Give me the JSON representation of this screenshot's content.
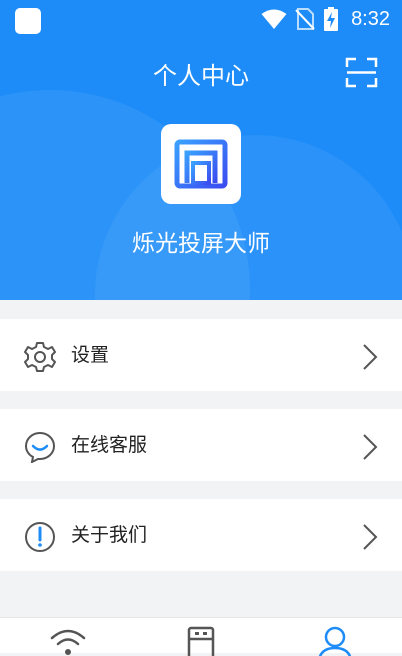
{
  "colors": {
    "brand": "#1d8cf8",
    "background": "#f2f3f5",
    "card": "#ffffff",
    "text": "#222222",
    "icon_gray": "#555555"
  },
  "status_bar": {
    "time": "8:32",
    "icons": [
      "wifi-icon",
      "no-sim-icon",
      "battery-charging-icon"
    ]
  },
  "header": {
    "title": "个人中心",
    "scan_icon": "scan-icon"
  },
  "profile": {
    "logo_icon": "app-logo-icon",
    "app_name": "烁光投屏大师"
  },
  "menu": [
    {
      "label": "设置",
      "icon": "gear-icon"
    },
    {
      "label": "在线客服",
      "icon": "chat-bubble-icon"
    },
    {
      "label": "关于我们",
      "icon": "info-icon"
    }
  ],
  "tab_bar": {
    "tabs": [
      {
        "icon": "wifi-icon",
        "active": false
      },
      {
        "icon": "usb-icon",
        "active": false
      },
      {
        "icon": "user-icon",
        "active": true
      }
    ]
  }
}
